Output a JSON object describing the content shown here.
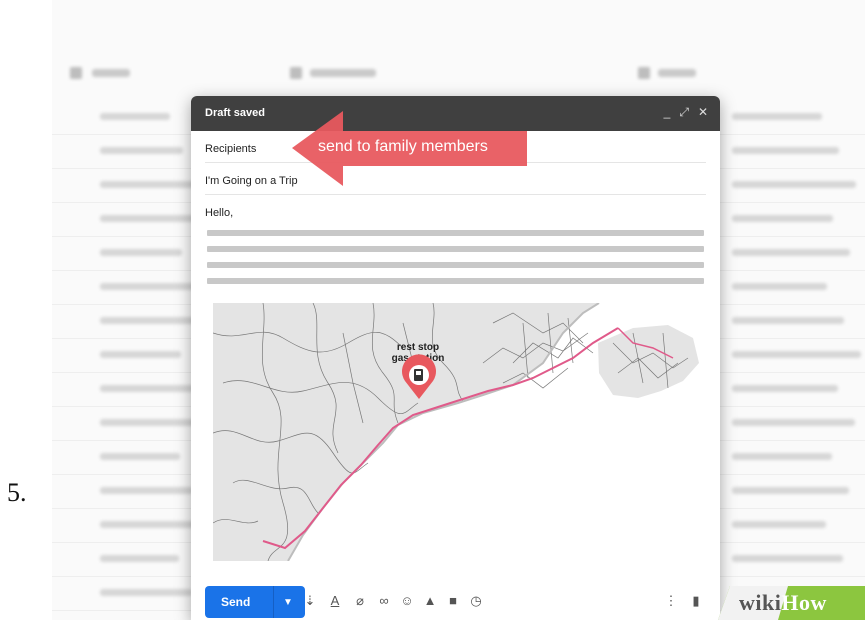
{
  "step_number": "5.",
  "compose": {
    "title": "Draft saved",
    "recipients_placeholder": "Recipients",
    "subject": "I'm Going on a Trip",
    "greeting": "Hello,",
    "send_label": "Send"
  },
  "annotation": {
    "text": "send to family members",
    "color": "#e8585e"
  },
  "map": {
    "labels": [
      "rest stop",
      "gas station"
    ],
    "marker_color": "#e8585e",
    "route_color": "#e05a8a"
  },
  "watermark": {
    "part1": "wiki",
    "part2": "How",
    "color": "#8cc63f"
  },
  "toolbar_icons": [
    "formatting-icon",
    "text-color-icon",
    "attach-icon",
    "link-icon",
    "emoji-icon",
    "drive-icon",
    "photo-icon",
    "confidential-icon",
    "more-options-icon",
    "delete-icon"
  ]
}
